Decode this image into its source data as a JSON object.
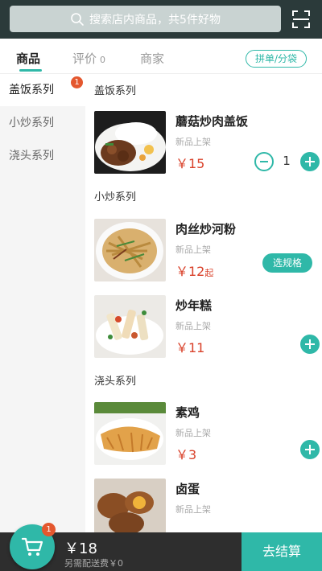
{
  "search": {
    "placeholder": "搜索店内商品，共5件好物"
  },
  "tabs": [
    {
      "label": "商品"
    },
    {
      "label": "评价",
      "count": "0"
    },
    {
      "label": "商家"
    }
  ],
  "split_order_label": "拼单/分袋",
  "sidebar": {
    "items": [
      {
        "label": "盖饭系列",
        "badge": "1"
      },
      {
        "label": "小炒系列"
      },
      {
        "label": "浇头系列"
      }
    ]
  },
  "sections": [
    {
      "title": "盖饭系列",
      "items": [
        {
          "name": "蘑菇炒肉盖饭",
          "tag": "新品上架",
          "price": "￥15",
          "quantity": "1"
        }
      ]
    },
    {
      "title": "小炒系列",
      "items": [
        {
          "name": "肉丝炒河粉",
          "tag": "新品上架",
          "price": "￥12",
          "price_suffix": "起",
          "action": "选规格"
        },
        {
          "name": "炒年糕",
          "tag": "新品上架",
          "price": "￥11"
        }
      ]
    },
    {
      "title": "浇头系列",
      "items": [
        {
          "name": "素鸡",
          "tag": "新品上架",
          "price": "￥3"
        },
        {
          "name": "卤蛋",
          "tag": "新品上架"
        }
      ]
    }
  ],
  "cart": {
    "badge": "1",
    "total": "￥18",
    "delivery_note": "另需配送费￥0",
    "checkout_label": "去结算"
  },
  "colors": {
    "accent": "#2fb8a8",
    "price": "#d9412a",
    "header": "#2b3a3a",
    "badge": "#e4572e"
  }
}
